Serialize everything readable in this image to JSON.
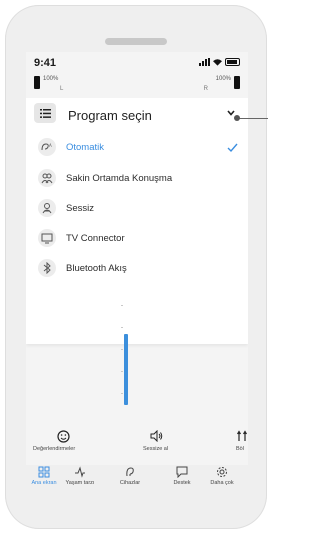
{
  "status_bar": {
    "time": "9:41"
  },
  "hearing_aids": {
    "left": {
      "battery": "100%",
      "side": "L"
    },
    "right": {
      "battery": "100%",
      "side": "R"
    }
  },
  "program_dropdown": {
    "title": "Program seçin",
    "programs": [
      {
        "label": "Otomatik",
        "icon": "automatic-icon",
        "selected": true
      },
      {
        "label": "Sakin Ortamda Konuşma",
        "icon": "conversation-icon",
        "selected": false
      },
      {
        "label": "Sessiz",
        "icon": "mute-icon",
        "selected": false
      },
      {
        "label": "TV Connector",
        "icon": "tv-icon",
        "selected": false
      },
      {
        "label": "Bluetooth Akış",
        "icon": "bluetooth-icon",
        "selected": false
      }
    ]
  },
  "volume_level": 0.65,
  "actions": {
    "feedback": "Değerlendirmeler",
    "mute": "Sessize al",
    "split": "Böl"
  },
  "tabs": [
    {
      "label": "Ana ekran",
      "icon": "home-grid-icon",
      "active": true
    },
    {
      "label": "Yaşam tarzı",
      "icon": "pulse-icon",
      "active": false
    },
    {
      "label": "Cihazlar",
      "icon": "hearing-aid-icon",
      "active": false
    },
    {
      "label": "Destek",
      "icon": "chat-icon",
      "active": false
    },
    {
      "label": "Daha çok",
      "icon": "gear-icon",
      "active": false
    }
  ],
  "colors": {
    "accent": "#3b8ee0"
  }
}
